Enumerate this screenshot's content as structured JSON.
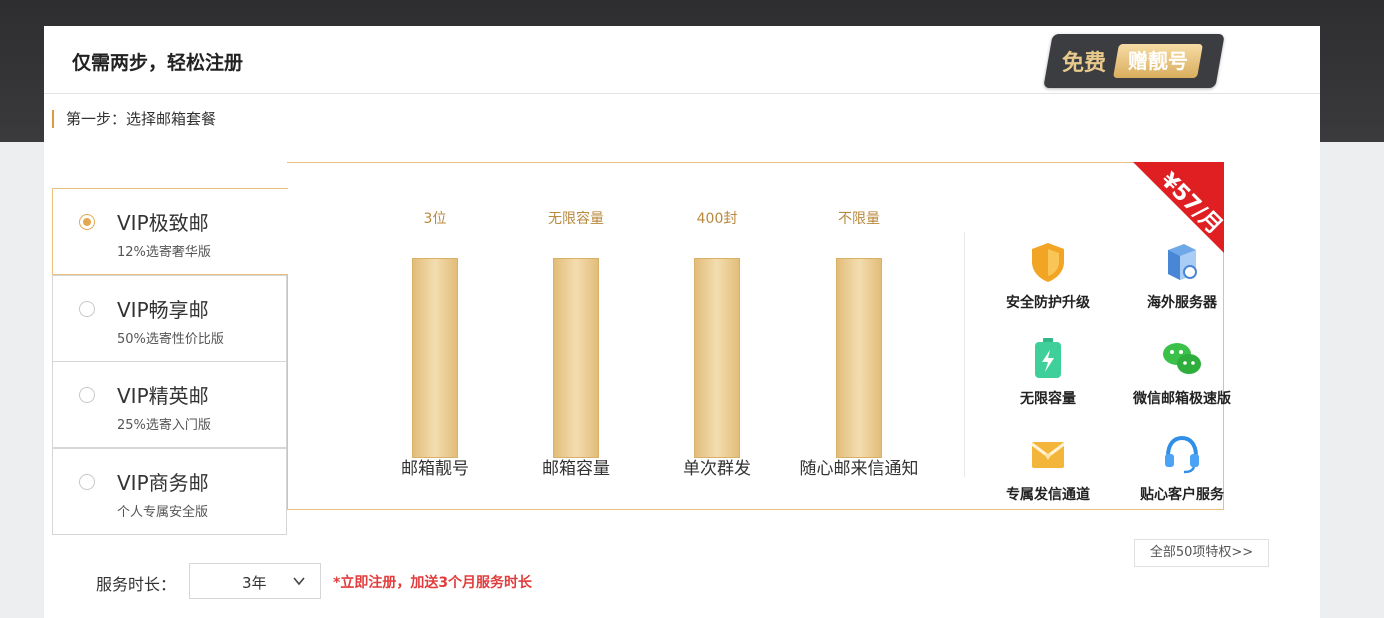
{
  "header": {
    "title": "仅需两步，轻松注册"
  },
  "promo": {
    "free": "免费",
    "gift": "赠靓号"
  },
  "step1": {
    "title": "第一步：选择邮箱套餐"
  },
  "packages": [
    {
      "name": "VIP极致邮",
      "sub": "12%选寄奢华版",
      "selected": true
    },
    {
      "name": "VIP畅享邮",
      "sub": "50%选寄性价比版",
      "selected": false
    },
    {
      "name": "VIP精英邮",
      "sub": "25%选寄入门版",
      "selected": false
    },
    {
      "name": "VIP商务邮",
      "sub": "个人专属安全版",
      "selected": false
    }
  ],
  "price_corner": "¥57/月",
  "bars": [
    {
      "value": "3位",
      "label": "邮箱靓号"
    },
    {
      "value": "无限容量",
      "label": "邮箱容量"
    },
    {
      "value": "400封",
      "label": "单次群发"
    },
    {
      "value": "不限量",
      "label": "随心邮来信通知"
    }
  ],
  "features": [
    {
      "icon": "shield-icon",
      "label": "安全防护升级"
    },
    {
      "icon": "server-icon",
      "label": "海外服务器"
    },
    {
      "icon": "battery-icon",
      "label": "无限容量"
    },
    {
      "icon": "wechat-icon",
      "label": "微信邮箱极速版"
    },
    {
      "icon": "envelope-icon",
      "label": "专属发信通道"
    },
    {
      "icon": "headset-icon",
      "label": "贴心客户服务"
    }
  ],
  "more_link": "全部50项特权>>",
  "duration": {
    "label": "服务时长：",
    "value": "3年",
    "note": "*立即注册，加送3个月服务时长"
  },
  "colors": {
    "accent": "#e4a851",
    "bar_gold": "#e2bd79",
    "corner_red": "#e01f23",
    "note_red": "#e23b3b",
    "badge_dark": "#3c3d40"
  }
}
